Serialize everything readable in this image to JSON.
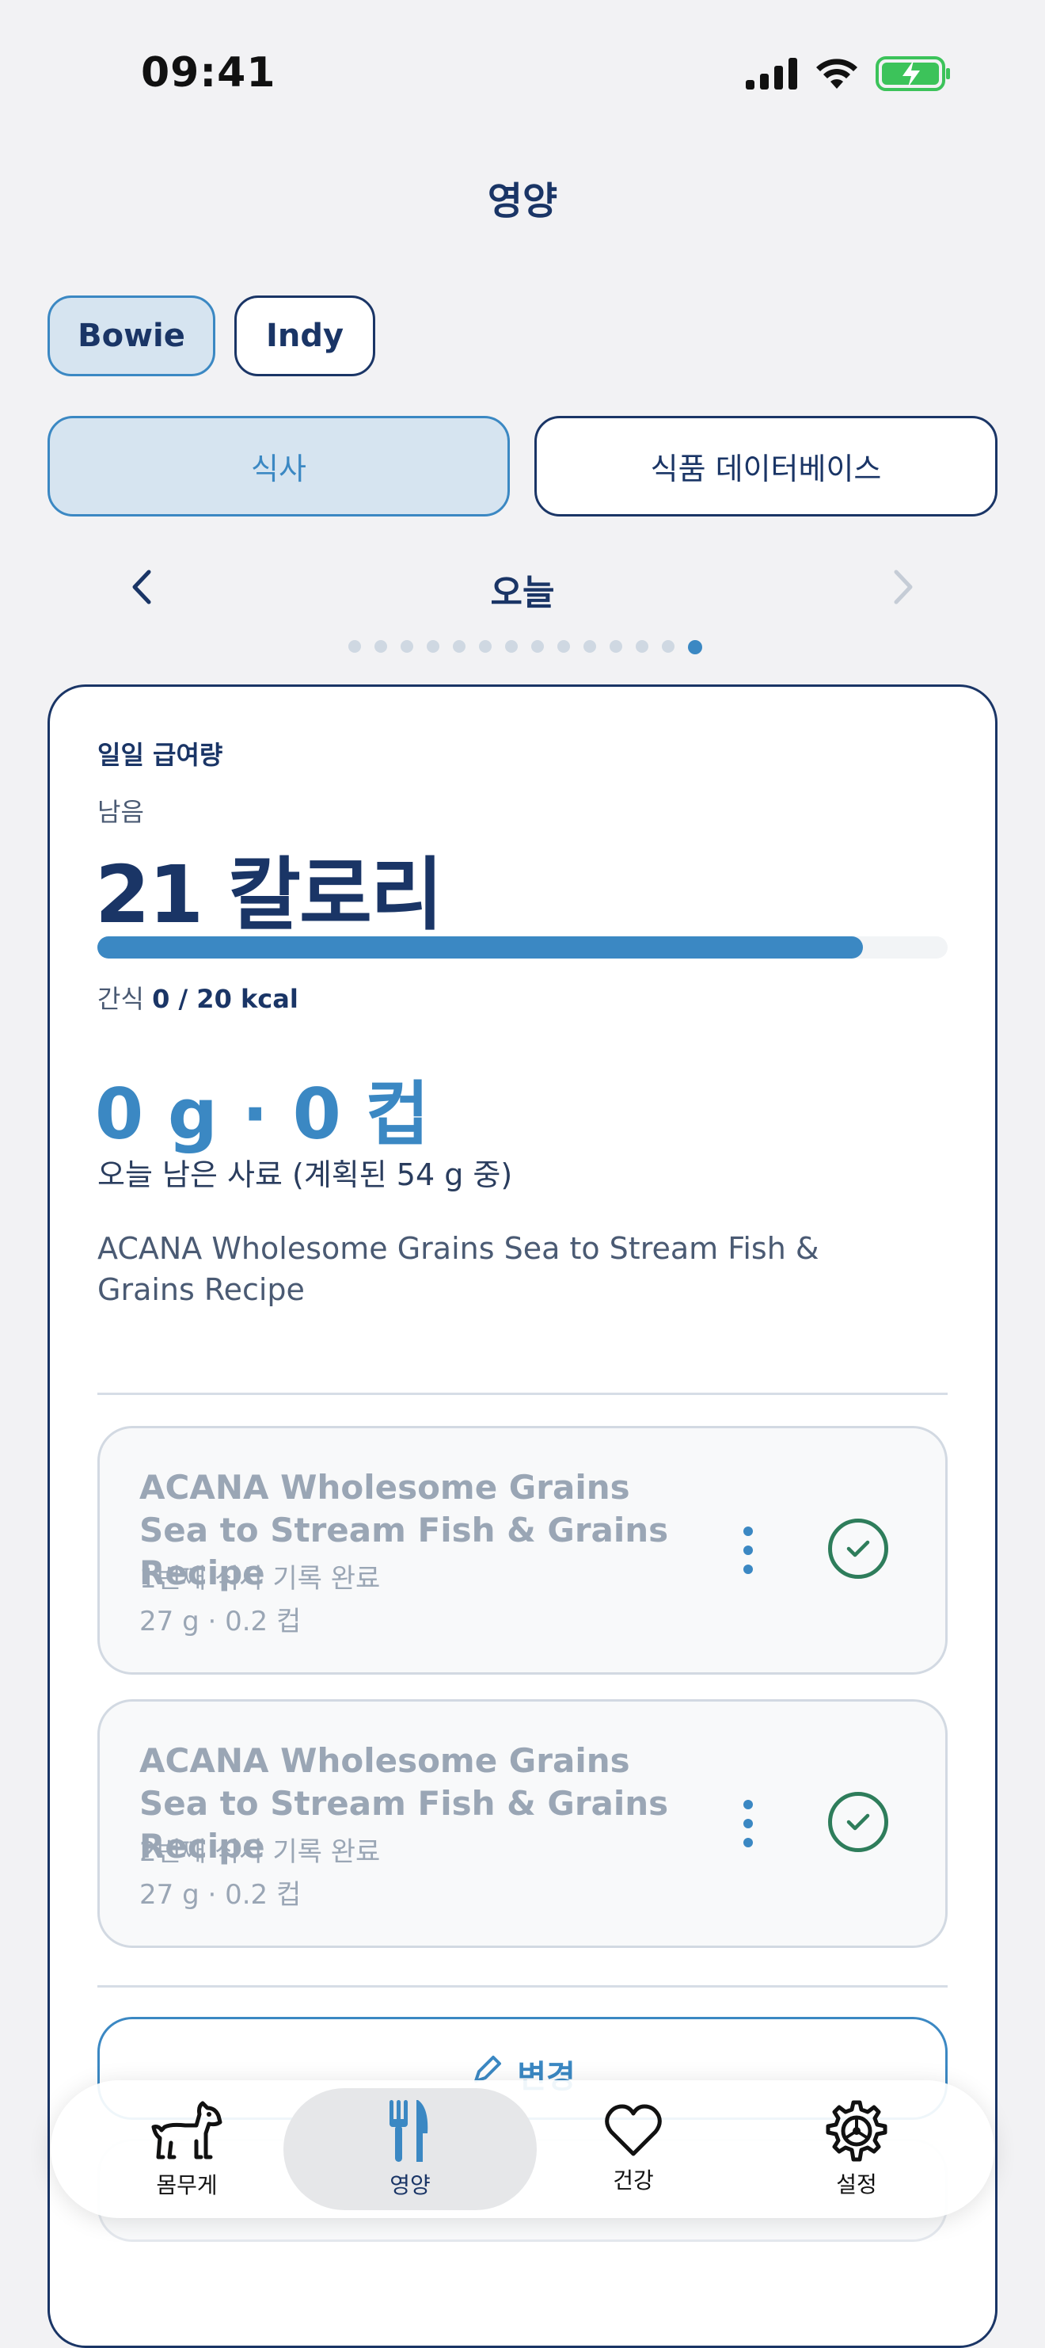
{
  "status_bar": {
    "time": "09:41"
  },
  "header": {
    "title": "영양"
  },
  "pets": [
    {
      "name": "Bowie",
      "active": true
    },
    {
      "name": "Indy",
      "active": false
    }
  ],
  "segments": [
    {
      "label": "식사",
      "active": true
    },
    {
      "label": "식품 데이터베이스",
      "active": false
    }
  ],
  "day_nav": {
    "label": "오늘",
    "page_count": 14,
    "current_page": 14
  },
  "daily": {
    "section_label": "일일 급여량",
    "remaining_label": "남음",
    "remaining_calories": "21 칼로리",
    "progress_fraction": 0.9,
    "snack_label": "간식",
    "snack_value": "0 / 20 kcal",
    "food_remaining": "0 g · 0 컵",
    "food_remaining_caption": "오늘 남은 사료 (계획된 54 g 중)",
    "food_name": "ACANA Wholesome Grains Sea to Stream Fish & Grains Recipe"
  },
  "meals": [
    {
      "title": "ACANA Wholesome Grains Sea to Stream Fish & Grains Recipe",
      "status": "1번째 식사 기록 완료",
      "amount": "27 g · 0.2 컵"
    },
    {
      "title": "ACANA Wholesome Grains Sea to Stream Fish & Grains Recipe",
      "status": "2번째 식사 기록 완료",
      "amount": "27 g · 0.2 컵"
    }
  ],
  "actions": {
    "change_label": "변경"
  },
  "tabbar": {
    "items": [
      {
        "label": "몸무게",
        "icon": "dog-icon"
      },
      {
        "label": "영양",
        "icon": "fork-knife-icon",
        "active": true
      },
      {
        "label": "건강",
        "icon": "heart-icon"
      },
      {
        "label": "설정",
        "icon": "gear-icon"
      }
    ]
  },
  "colors": {
    "primary": "#1a3566",
    "accent": "#3b88c3",
    "accent_light": "#d6e4f0",
    "success": "#2e7d5b",
    "battery": "#3cc35a"
  }
}
